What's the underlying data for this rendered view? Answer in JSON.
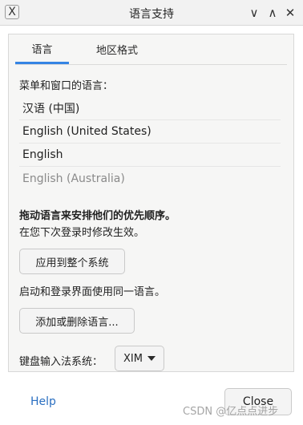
{
  "window": {
    "title": "语言支持",
    "minimize_glyph": "∨",
    "maximize_glyph": "∧",
    "close_glyph": "✕",
    "app_icon_glyph": "X"
  },
  "tabs": [
    {
      "label": "语言",
      "active": true
    },
    {
      "label": "地区格式",
      "active": false
    }
  ],
  "language_section": {
    "heading": "菜单和窗口的语言：",
    "languages": [
      {
        "name": "汉语 (中国)",
        "enabled": true
      },
      {
        "name": "English (United States)",
        "enabled": true
      },
      {
        "name": "English",
        "enabled": true
      },
      {
        "name": "English (Australia)",
        "enabled": false
      }
    ],
    "drag_hint": "拖动语言来安排他们的优先顺序。",
    "effect_hint": "在您下次登录时修改生效。",
    "apply_button": "应用到整个系统",
    "login_hint": "启动和登录界面使用同一语言。",
    "add_remove_button": "添加或删除语言...",
    "input_method_label": "键盘输入法系统：",
    "input_method_value": "XIM"
  },
  "footer": {
    "help_label": "Help",
    "close_label": "Close",
    "watermark": "CSDN @亿点点进步"
  },
  "colors": {
    "accent": "#3584e4",
    "link": "#2a6fc1"
  }
}
